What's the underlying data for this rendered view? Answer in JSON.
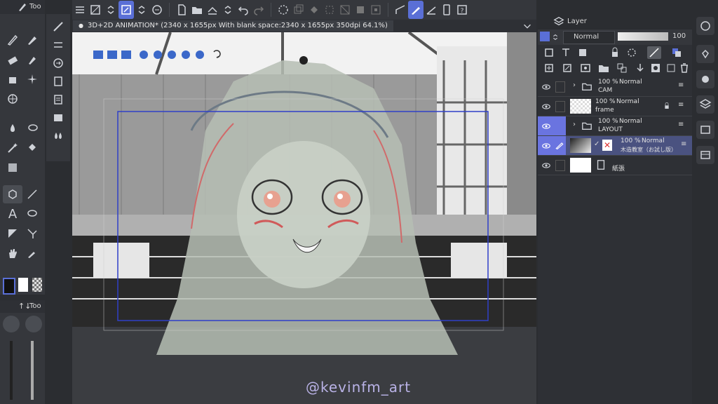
{
  "left_panel": {
    "tool_tab_label": "Too",
    "subtool_tab_label": "Too"
  },
  "document": {
    "tab_title": "3D+2D ANIMATION* (2340 x 1655px With blank space:2340 x 1655px 350dpi 64.1%)"
  },
  "layer_panel": {
    "title": "Layer",
    "blend_mode": "Normal",
    "opacity_value": "100",
    "layers": [
      {
        "opacity": "100 %",
        "mode": "Normal",
        "name": "CAM"
      },
      {
        "opacity": "100 %",
        "mode": "Normal",
        "name": "frame"
      },
      {
        "opacity": "100 %",
        "mode": "Normal",
        "name": "LAYOUT"
      },
      {
        "opacity": "100 %",
        "mode": "Normal",
        "name": "木造教室（お試し版）"
      },
      {
        "name": "紙張"
      }
    ]
  },
  "watermark": "@kevinfm_art",
  "colors": {
    "accent": "#5a6fd6",
    "selection": "#4a5280",
    "blue_frame": "#2f3fc8"
  }
}
